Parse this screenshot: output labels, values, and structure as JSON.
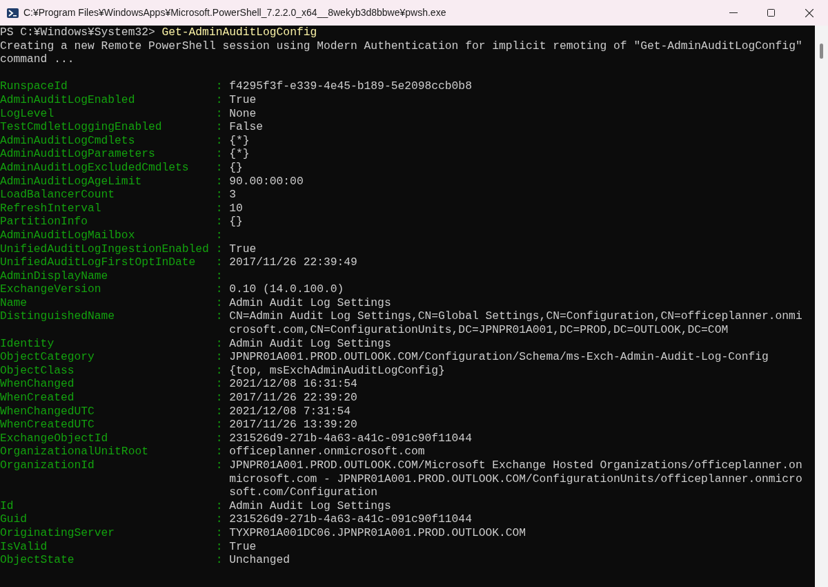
{
  "window": {
    "title": "C:¥Program Files¥WindowsApps¥Microsoft.PowerShell_7.2.2.0_x64__8wekyb3d8bbwe¥pwsh.exe"
  },
  "prompt": {
    "path": "PS C:¥Windows¥System32> ",
    "command": "Get-AdminAuditLogConfig"
  },
  "message": "Creating a new Remote PowerShell session using Modern Authentication for implicit remoting of \"Get-AdminAuditLogConfig\" command ...",
  "properties": [
    {
      "name": "RunspaceId",
      "sep": ":",
      "value": "f4295f3f-e339-4e45-b189-5e2098ccb0b8"
    },
    {
      "name": "AdminAuditLogEnabled",
      "sep": ":",
      "value": "True"
    },
    {
      "name": "LogLevel",
      "sep": ":",
      "value": "None"
    },
    {
      "name": "TestCmdletLoggingEnabled",
      "sep": ":",
      "value": "False"
    },
    {
      "name": "AdminAuditLogCmdlets",
      "sep": ":",
      "value": "{*}"
    },
    {
      "name": "AdminAuditLogParameters",
      "sep": ":",
      "value": "{*}"
    },
    {
      "name": "AdminAuditLogExcludedCmdlets",
      "sep": ":",
      "value": "{}"
    },
    {
      "name": "AdminAuditLogAgeLimit",
      "sep": ":",
      "value": "90.00:00:00"
    },
    {
      "name": "LoadBalancerCount",
      "sep": ":",
      "value": "3"
    },
    {
      "name": "RefreshInterval",
      "sep": ":",
      "value": "10"
    },
    {
      "name": "PartitionInfo",
      "sep": ":",
      "value": "{}"
    },
    {
      "name": "AdminAuditLogMailbox",
      "sep": ":"
    },
    {
      "name": "UnifiedAuditLogIngestionEnabled",
      "sep": ":",
      "value": "True"
    },
    {
      "name": "UnifiedAuditLogFirstOptInDate",
      "sep": ":",
      "value": "2017/11/26 22:39:49"
    },
    {
      "name": "AdminDisplayName",
      "sep": ":"
    },
    {
      "name": "ExchangeVersion",
      "sep": ":",
      "value": "0.10 (14.0.100.0)"
    },
    {
      "name": "Name",
      "sep": ":",
      "value": "Admin Audit Log Settings"
    },
    {
      "name": "DistinguishedName",
      "sep": ":",
      "value": "CN=Admin Audit Log Settings,CN=Global Settings,CN=Configuration,CN=officeplanner.onmicrosoft.com,CN=ConfigurationUnits,DC=JPNPR01A001,DC=PROD,DC=OUTLOOK,DC=COM"
    },
    {
      "name": "Identity",
      "sep": ":",
      "value": "Admin Audit Log Settings"
    },
    {
      "name": "ObjectCategory",
      "sep": ":",
      "value": "JPNPR01A001.PROD.OUTLOOK.COM/Configuration/Schema/ms-Exch-Admin-Audit-Log-Config"
    },
    {
      "name": "ObjectClass",
      "sep": ":",
      "value": "{top, msExchAdminAuditLogConfig}"
    },
    {
      "name": "WhenChanged",
      "sep": ":",
      "value": "2021/12/08 16:31:54"
    },
    {
      "name": "WhenCreated",
      "sep": ":",
      "value": "2017/11/26 22:39:20"
    },
    {
      "name": "WhenChangedUTC",
      "sep": ":",
      "value": "2021/12/08 7:31:54"
    },
    {
      "name": "WhenCreatedUTC",
      "sep": ":",
      "value": "2017/11/26 13:39:20"
    },
    {
      "name": "ExchangeObjectId",
      "sep": ":",
      "value": "231526d9-271b-4a63-a41c-091c90f11044"
    },
    {
      "name": "OrganizationalUnitRoot",
      "sep": ":",
      "value": "officeplanner.onmicrosoft.com"
    },
    {
      "name": "OrganizationId",
      "sep": ":",
      "value": "JPNPR01A001.PROD.OUTLOOK.COM/Microsoft Exchange Hosted Organizations/officeplanner.onmicrosoft.com - JPNPR01A001.PROD.OUTLOOK.COM/ConfigurationUnits/officeplanner.onmicrosoft.com/Configuration"
    },
    {
      "name": "Id",
      "sep": ":",
      "value": "Admin Audit Log Settings"
    },
    {
      "name": "Guid",
      "sep": ":",
      "value": "231526d9-271b-4a63-a41c-091c90f11044"
    },
    {
      "name": "OriginatingServer",
      "sep": ":",
      "value": "TYXPR01A001DC06.JPNPR01A001.PROD.OUTLOOK.COM"
    },
    {
      "name": "IsValid",
      "sep": ":",
      "value": "True"
    },
    {
      "name": "ObjectState",
      "sep": ":",
      "value": "Unchanged"
    }
  ]
}
